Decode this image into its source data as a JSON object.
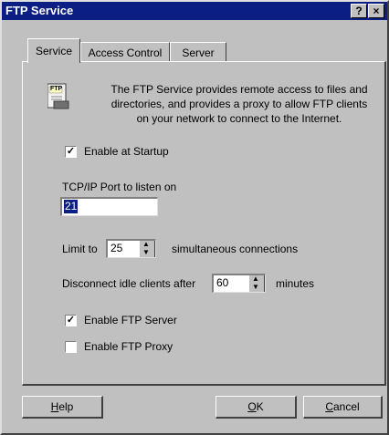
{
  "window": {
    "title": "FTP Service",
    "help_glyph": "?",
    "close_glyph": "×"
  },
  "tabs": [
    {
      "label": "Service",
      "active": true
    },
    {
      "label": "Access Control",
      "active": false
    },
    {
      "label": "Server",
      "active": false
    }
  ],
  "icon": {
    "name": "ftp-document-icon",
    "text": "FTP"
  },
  "description": "The FTP Service provides remote access to files and directories, and provides a proxy to allow FTP clients on your network to connect to the Internet.",
  "enable_startup": {
    "label": "Enable at Startup",
    "checked": true,
    "mark": "✓"
  },
  "port": {
    "label": "TCP/IP Port to listen on",
    "value": "21"
  },
  "limit": {
    "prefix": "Limit to",
    "value": "25",
    "suffix": "simultaneous connections"
  },
  "idle": {
    "prefix": "Disconnect idle clients after",
    "value": "60",
    "suffix": "minutes"
  },
  "enable_server": {
    "label": "Enable FTP Server",
    "checked": true,
    "mark": "✓"
  },
  "enable_proxy": {
    "label": "Enable FTP Proxy",
    "checked": false
  },
  "buttons": {
    "help": {
      "key": "H",
      "rest": "elp"
    },
    "ok": {
      "key": "O",
      "rest": "K"
    },
    "cancel": {
      "key": "C",
      "rest": "ancel"
    }
  },
  "spinner_arrows": {
    "up": "▲",
    "down": "▼"
  }
}
